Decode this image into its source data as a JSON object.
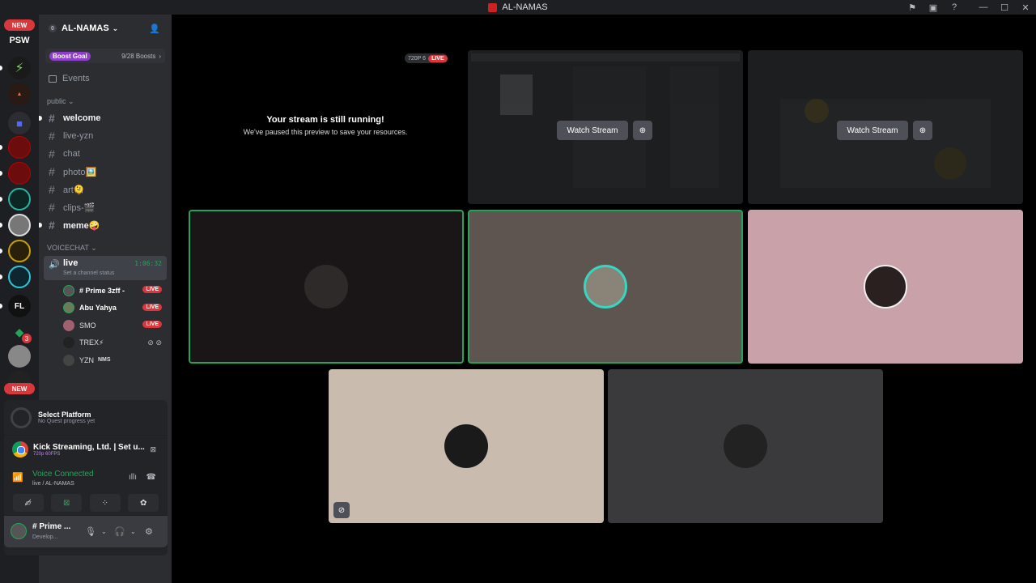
{
  "title_bar": {
    "app_title": "AL-NAMAS"
  },
  "guilds": {
    "new_badge": "NEW",
    "psw_label": "PSW",
    "mention_count": "3",
    "fl_label": "FL",
    "bottom_new_badge": "NEW"
  },
  "server": {
    "name": "AL-NAMAS",
    "notif_count": "0"
  },
  "boost": {
    "goal_label": "Boost Goal",
    "count": "9/28 Boosts"
  },
  "events_label": "Events",
  "categories": {
    "public": "public",
    "voicechat": "VOICECHAT"
  },
  "channels": [
    {
      "name": "welcome",
      "unread": true
    },
    {
      "name": "live-yzn",
      "unread": false
    },
    {
      "name": "chat",
      "unread": false
    },
    {
      "name": "photo🖼️",
      "unread": false
    },
    {
      "name": "art🫠",
      "unread": false
    },
    {
      "name": "clips-🎬",
      "unread": false
    },
    {
      "name": "meme🤪",
      "unread": true
    }
  ],
  "voice_channel": {
    "name": "live",
    "timer": "1:06:32",
    "status_hint": "Set a channel status"
  },
  "voice_users": [
    {
      "name": "# Prime 3zff -",
      "live": "LIVE"
    },
    {
      "name": "Abu Yahya",
      "live": "LIVE"
    },
    {
      "name": "SMO",
      "live": "LIVE"
    },
    {
      "name": "TREX⚡",
      "live": ""
    },
    {
      "name": "YZN",
      "tag": "NMS",
      "live": ""
    }
  ],
  "panel": {
    "quest_title": "Select Platform",
    "quest_sub": "No Quest progress yet",
    "activity_title": "Kick Streaming, Ltd. | Set u...",
    "activity_quality": "720p 60FPS",
    "voice_title": "Voice Connected",
    "voice_sub": "live / AL-NAMAS",
    "user_name": "# Prime ...",
    "user_status": "Develop..."
  },
  "stream_tiles": {
    "paused_title": "Your stream is still running!",
    "paused_sub": "We've paused this preview to save your resources.",
    "quality": "720P 6",
    "live_badge": "LIVE",
    "watch_label": "Watch Stream"
  },
  "colors": {
    "speaking": "#23a559",
    "live": "#da373c",
    "tile_pink": "#c8a2a8",
    "tile_beige": "#c9bcae",
    "tile_taupe": "#5f5550",
    "tile_dark": "#1a1618",
    "tile_gray": "#3a3a3c"
  }
}
